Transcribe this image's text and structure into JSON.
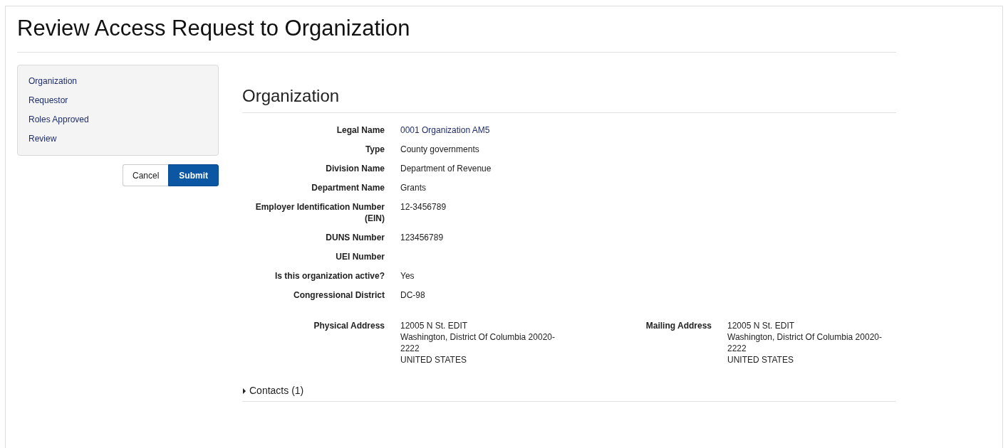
{
  "page_title": "Review Access Request to Organization",
  "sidebar": {
    "items": [
      {
        "label": "Organization"
      },
      {
        "label": "Requestor"
      },
      {
        "label": "Roles Approved"
      },
      {
        "label": "Review"
      }
    ]
  },
  "buttons": [
    {
      "label": "Cancel",
      "kind": "secondary"
    },
    {
      "label": "Submit",
      "kind": "primary"
    }
  ],
  "section": {
    "heading": "Organization",
    "fields": [
      {
        "label": "Legal Name",
        "value": "0001 Organization AM5",
        "kind": "link"
      },
      {
        "label": "Type",
        "value": "County governments",
        "kind": "text"
      },
      {
        "label": "Division Name",
        "value": "Department of Revenue",
        "kind": "text"
      },
      {
        "label": "Department Name",
        "value": "Grants",
        "kind": "text"
      },
      {
        "label": "Employer Identification Number (EIN)",
        "value": "12-3456789",
        "kind": "text"
      },
      {
        "label": "DUNS Number",
        "value": "123456789",
        "kind": "text"
      },
      {
        "label": "UEI Number",
        "kind": "text"
      },
      {
        "label": "Is this organization active?",
        "value": "Yes",
        "kind": "text"
      },
      {
        "label": "Congressional District",
        "value": "DC-98",
        "kind": "text"
      }
    ],
    "addresses": [
      {
        "label": "Physical Address",
        "lines": [
          "12005 N St. EDIT",
          "Washington, District Of Columbia 20020-",
          "2222",
          "UNITED STATES"
        ]
      },
      {
        "label": "Mailing Address",
        "lines": [
          "12005 N St. EDIT",
          "Washington, District Of Columbia 20020-",
          "2222",
          "UNITED STATES"
        ]
      }
    ]
  },
  "contacts": {
    "label": "Contacts (1)",
    "expanded": false
  }
}
